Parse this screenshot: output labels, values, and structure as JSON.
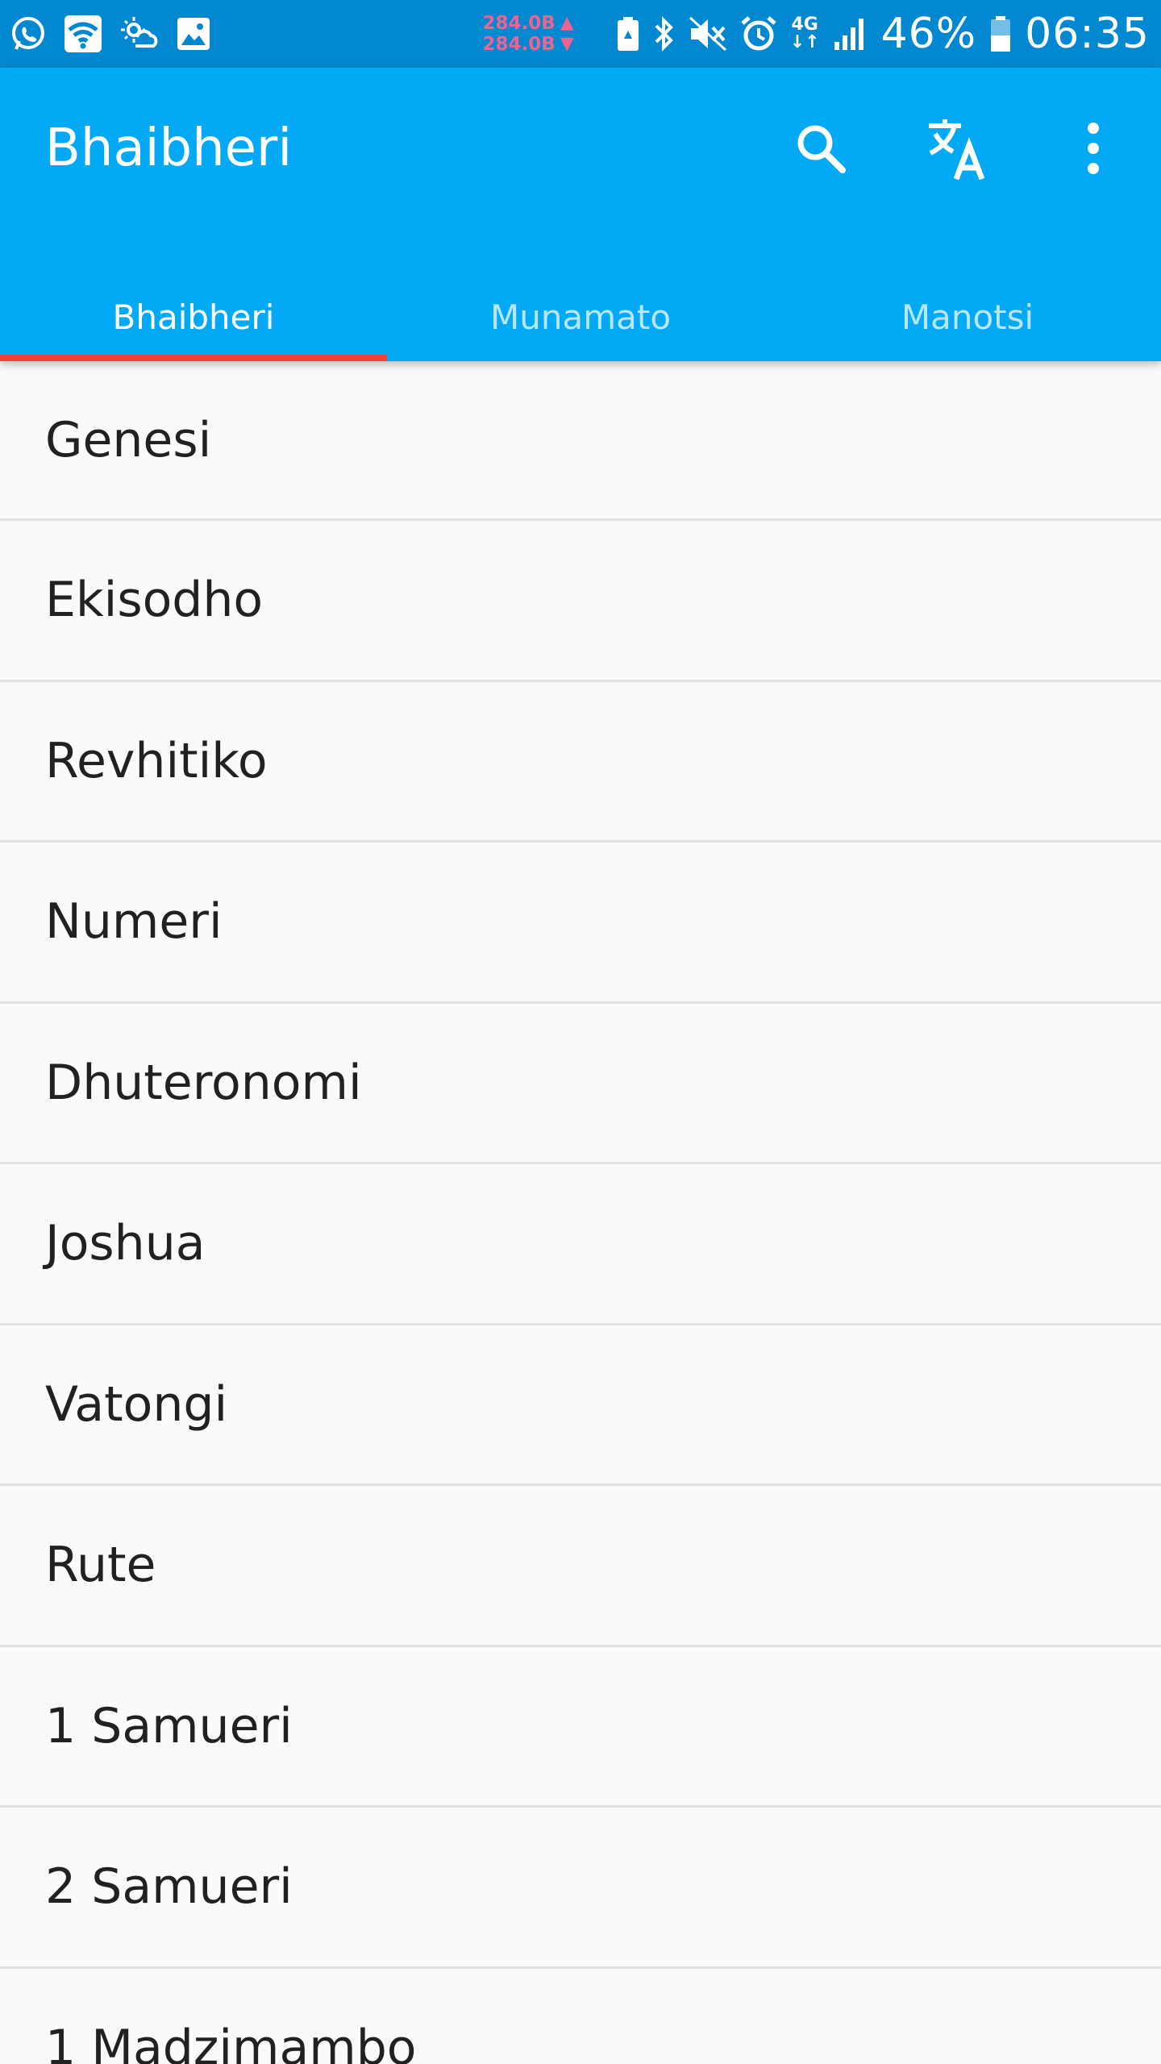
{
  "status_bar": {
    "left_icons": [
      "whatsapp-icon",
      "wifi-icon",
      "weather-icon",
      "image-icon"
    ],
    "net_up": "284.0B",
    "net_down": "284.0B",
    "right_icons": [
      "battery-saver-icon",
      "bluetooth-icon",
      "mute-icon",
      "alarm-icon"
    ],
    "network_type": "4G",
    "battery": "46%",
    "time": "06:35"
  },
  "app_bar": {
    "title": "Bhaibheri",
    "actions": [
      "search-icon",
      "translate-icon",
      "more-vert-icon"
    ],
    "background": "#03a9f4",
    "status_bar_color": "#0288d1"
  },
  "tabs": [
    {
      "label": "Bhaibheri",
      "active": true
    },
    {
      "label": "Munamato",
      "active": false
    },
    {
      "label": "Manotsi",
      "active": false
    }
  ],
  "tab_indicator_color": "#f44336",
  "books": [
    "Genesi",
    "Ekisodho",
    "Revhitiko",
    "Numeri",
    "Dhuteronomi",
    "Joshua",
    "Vatongi",
    "Rute",
    "1 Samueri",
    "2 Samueri",
    "1 Madzimambo"
  ]
}
